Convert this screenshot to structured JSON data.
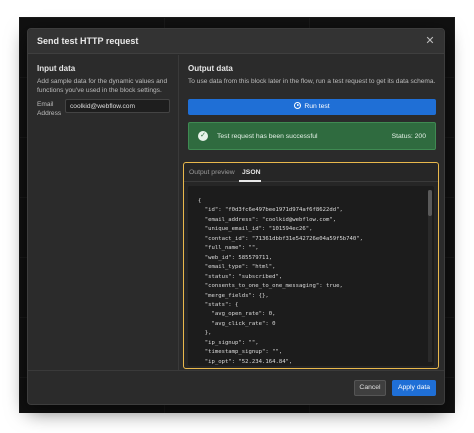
{
  "modal": {
    "title": "Send test HTTP request",
    "close_icon": "close-icon"
  },
  "input_data": {
    "title": "Input data",
    "description": "Add sample data for the dynamic values and functions you've used in the block settings.",
    "email_label": "Email Address",
    "email_value": "coolkid@webflow.com"
  },
  "output_data": {
    "title": "Output data",
    "description": "To use data from this block later in the flow, run a test request to get its data schema.",
    "run_button": "Run test",
    "run_icon": "play-icon",
    "success_message": "Test request has been successful",
    "status": "Status: 200",
    "success_icon": "check-circle-icon",
    "tabs": [
      "Output preview",
      "JSON"
    ],
    "active_tab": "JSON",
    "json_text": "{\n  \"id\": \"f0d3fc6e497bee1971d974af6f8622dd\",\n  \"email_address\": \"coolkid@webflow.com\",\n  \"unique_email_id\": \"101594ec26\",\n  \"contact_id\": \"71361dbbf31e542726e04a59f5b740\",\n  \"full_name\": \"\",\n  \"web_id\": 585579711,\n  \"email_type\": \"html\",\n  \"status\": \"subscribed\",\n  \"consents_to_one_to_one_messaging\": true,\n  \"merge_fields\": {},\n  \"stats\": {\n    \"avg_open_rate\": 0,\n    \"avg_click_rate\": 0\n  },\n  \"ip_signup\": \"\",\n  \"timestamp_signup\": \"\",\n  \"ip_opt\": \"52.234.164.84\","
  },
  "footer": {
    "cancel": "Cancel",
    "apply": "Apply data"
  },
  "colors": {
    "accent": "#1f6fd6",
    "success": "#2f6b3f",
    "highlight_border": "#e9b84c"
  }
}
